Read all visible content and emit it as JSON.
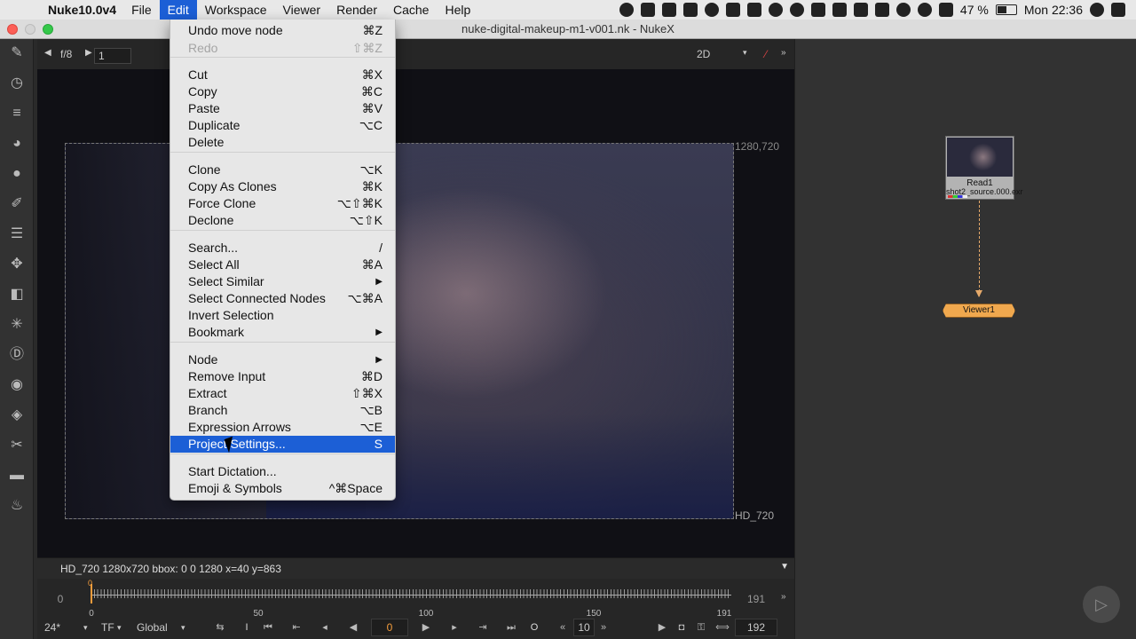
{
  "menubar": {
    "app_name": "Nuke10.0v4",
    "menus": [
      "File",
      "Edit",
      "Workspace",
      "Viewer",
      "Render",
      "Cache",
      "Help"
    ],
    "battery": "47 %",
    "clock": "Mon 22:36"
  },
  "window": {
    "title": "nuke-digital-makeup-m1-v001.nk - NukeX"
  },
  "viewer": {
    "fstop": "f/8",
    "frame_field": "1",
    "view_mode": "2D",
    "format_top_right": "1280,720",
    "format_bottom_right": "HD_720",
    "info": "HD_720 1280x720  bbox: 0 0 1280  x=40 y=863"
  },
  "timeline": {
    "start": "0",
    "end": "191",
    "labels": [
      "0",
      "50",
      "100",
      "150",
      "191"
    ],
    "current_frame": "0"
  },
  "transport": {
    "fps": "24*",
    "tf": "TF",
    "scope": "Global",
    "in_marker": "I",
    "current": "0",
    "out_marker": "O",
    "step": "10",
    "end_frame": "192"
  },
  "nodegraph": {
    "read_node": {
      "name": "Read1",
      "file": "shot2_source.000.exr"
    },
    "viewer_node": {
      "name": "Viewer1"
    }
  },
  "edit_menu": {
    "items": [
      {
        "label": "Undo move node",
        "shortcut": "⌘Z"
      },
      {
        "label": "Redo",
        "shortcut": "⇧⌘Z"
      },
      {
        "label": "Cut",
        "shortcut": "⌘X"
      },
      {
        "label": "Copy",
        "shortcut": "⌘C"
      },
      {
        "label": "Paste",
        "shortcut": "⌘V"
      },
      {
        "label": "Duplicate",
        "shortcut": "⌥C"
      },
      {
        "label": "Delete",
        "shortcut": ""
      },
      {
        "label": "Clone",
        "shortcut": "⌥K"
      },
      {
        "label": "Copy As Clones",
        "shortcut": "⌘K"
      },
      {
        "label": "Force Clone",
        "shortcut": "⌥⇧⌘K"
      },
      {
        "label": "Declone",
        "shortcut": "⌥⇧K"
      },
      {
        "label": "Search...",
        "shortcut": "/"
      },
      {
        "label": "Select All",
        "shortcut": "⌘A"
      },
      {
        "label": "Select Similar",
        "shortcut": "▶"
      },
      {
        "label": "Select Connected Nodes",
        "shortcut": "⌥⌘A"
      },
      {
        "label": "Invert Selection",
        "shortcut": ""
      },
      {
        "label": "Bookmark",
        "shortcut": "▶"
      },
      {
        "label": "Node",
        "shortcut": "▶"
      },
      {
        "label": "Remove Input",
        "shortcut": "⌘D"
      },
      {
        "label": "Extract",
        "shortcut": "⇧⌘X"
      },
      {
        "label": "Branch",
        "shortcut": "⌥B"
      },
      {
        "label": "Expression Arrows",
        "shortcut": "⌥E"
      },
      {
        "label": "Project Settings...",
        "shortcut": "S"
      },
      {
        "label": "Start Dictation...",
        "shortcut": ""
      },
      {
        "label": "Emoji & Symbols",
        "shortcut": "^⌘Space"
      }
    ]
  },
  "colors": {
    "menu_highlight": "#1c5fd6",
    "viewer_node": "#f0a84e",
    "timeline_cursor": "#f39c3c"
  },
  "icons": {
    "toolbar": [
      "brush-icon",
      "clock-icon",
      "channels-icon",
      "color-wheel-icon",
      "sphere-icon",
      "filter-icon",
      "layers-icon",
      "transform-icon",
      "3d-box-icon",
      "particles-icon",
      "deep-icon",
      "eye-icon",
      "tag-icon",
      "tools-icon",
      "drawer-icon",
      "fire-icon"
    ]
  }
}
